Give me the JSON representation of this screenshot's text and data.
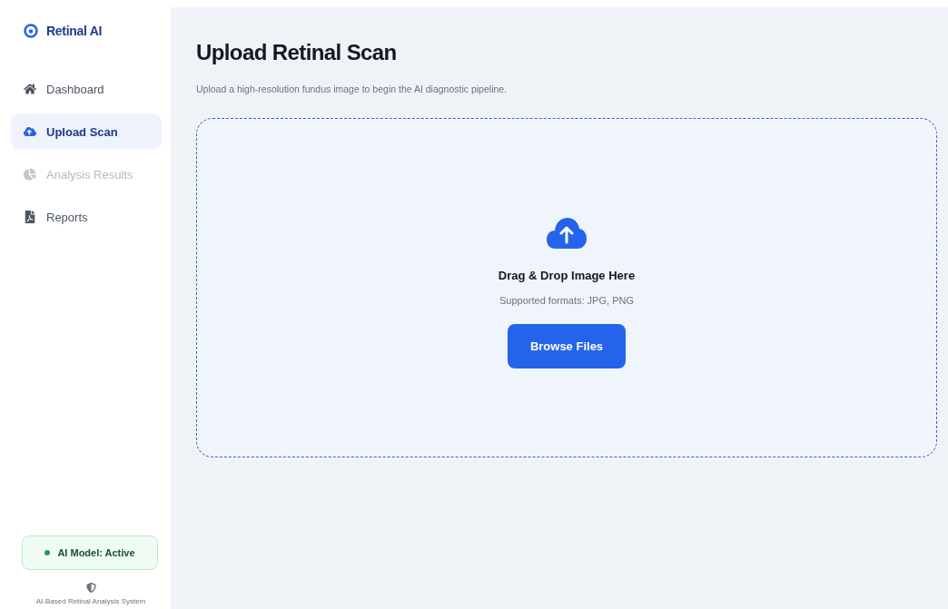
{
  "brand": {
    "name": "Retinal AI"
  },
  "nav": [
    {
      "label": "Dashboard",
      "kind": "home",
      "selected": false,
      "disabled": false
    },
    {
      "label": "Upload Scan",
      "kind": "upload",
      "selected": true,
      "disabled": false
    },
    {
      "label": "Analysis Results",
      "kind": "chart",
      "selected": false,
      "disabled": true
    },
    {
      "label": "Reports",
      "kind": "file",
      "selected": false,
      "disabled": false
    }
  ],
  "status": {
    "label": "AI Model: Active",
    "on": true
  },
  "footer": "AI-Based Retinal Analysis System",
  "page": {
    "title": "Upload Retinal Scan",
    "subtitle": "Upload a high-resolution fundus image to begin the AI diagnostic pipeline."
  },
  "dropzone": {
    "heading": "Drag & Drop Image Here",
    "hint": "Supported formats: JPG, PNG",
    "button": "Browse Files"
  }
}
